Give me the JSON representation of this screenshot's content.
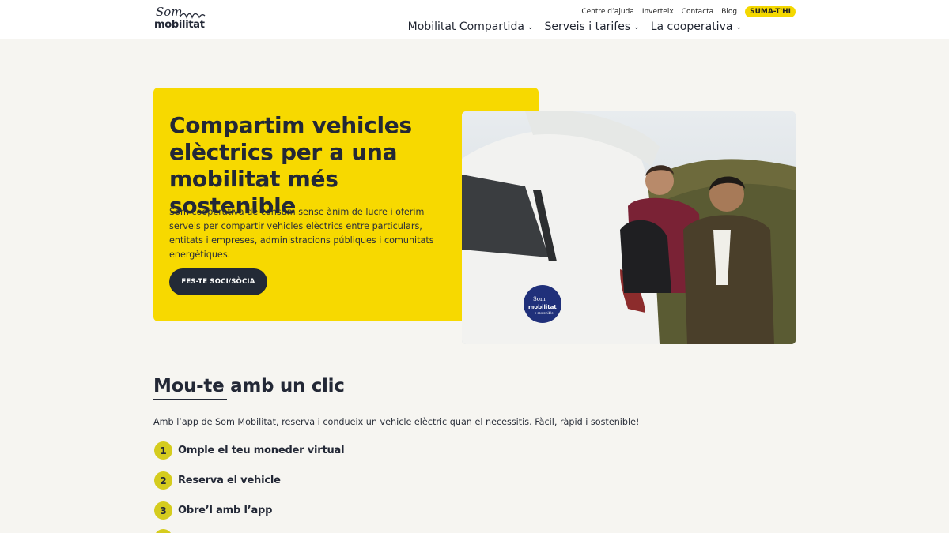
{
  "brand": {
    "logo_top": "Som",
    "logo_bottom": "mobilitat"
  },
  "topnav": {
    "links": [
      "Centre d’ajuda",
      "Inverteix",
      "Contacta",
      "Blog"
    ],
    "cta": "SUMA-T'HI"
  },
  "mainnav": {
    "items": [
      "Mobilitat Compartida",
      "Serveis i tarifes",
      "La cooperativa"
    ]
  },
  "hero": {
    "title": "Compartim vehicles elèctrics per a una mobilitat més sostenible",
    "text": "Som cooperativa de consum sense ànim de lucre i oferim serveis per compartir vehicles elèctrics entre particulars, entitats i empreses, administracions públiques i comunitats energètiques.",
    "cta": "FES-TE SOCI/SÒCIA",
    "photo_sticker_top": "Som",
    "photo_sticker_mid": "mobilitat",
    "photo_sticker_bottom": "+sostenible"
  },
  "section": {
    "title": "Mou-te amb un clic",
    "text": "Amb l’app de Som Mobilitat, reserva i condueix un vehicle elèctric quan el necessitis. Fàcil, ràpid i sostenible!",
    "steps": [
      {
        "num": "1",
        "label": "Omple el teu moneder virtual"
      },
      {
        "num": "2",
        "label": "Reserva el vehicle"
      },
      {
        "num": "3",
        "label": "Obre’l amb l’app"
      }
    ]
  },
  "colors": {
    "accent_yellow": "#f7d900",
    "step_circle": "#d5cc1e",
    "dark": "#232836",
    "background": "#f6f5f1"
  }
}
